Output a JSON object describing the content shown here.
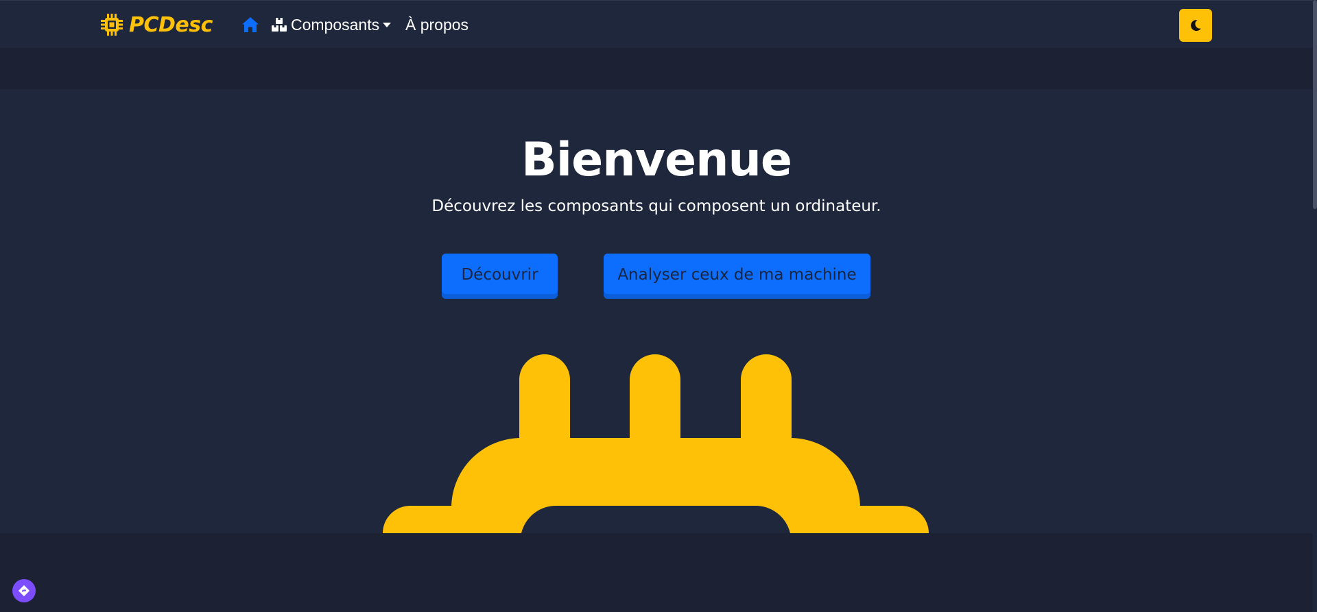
{
  "navbar": {
    "brand": "PCDesc",
    "brand_icon": "cpu-chip-icon",
    "home_icon": "home-icon",
    "components_icon": "boxes-icon",
    "components_label": "Composants",
    "about_label": "À propos",
    "theme_toggle_icon": "moon-icon"
  },
  "hero": {
    "title": "Bienvenue",
    "subtitle": "Découvrez les composants qui composent un ordinateur.",
    "discover_label": "Découvrir",
    "analyze_label": "Analyser ceux de ma machine",
    "illustration": "cpu-chip-illustration"
  },
  "colors": {
    "accent": "#ffc107",
    "primary": "#0d6efd",
    "background": "#1c2233",
    "navbar": "#1e273b"
  },
  "assist_icon": "diamond-nav-icon"
}
